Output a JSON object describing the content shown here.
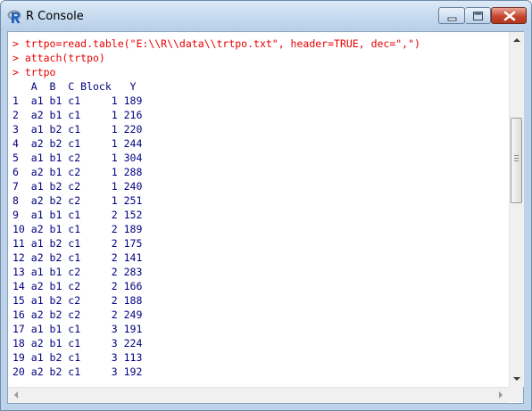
{
  "window": {
    "title": "R Console"
  },
  "console": {
    "lines": [
      {
        "kind": "cmd",
        "text": "> trtpo=read.table(\"E:\\\\R\\\\data\\\\trtpo.txt\", header=TRUE, dec=\",\")"
      },
      {
        "kind": "cmd",
        "text": "> attach(trtpo)"
      },
      {
        "kind": "cmd",
        "text": "> trtpo"
      },
      {
        "kind": "out",
        "text": "   A  B  C Block   Y"
      },
      {
        "kind": "out",
        "text": "1  a1 b1 c1     1 189"
      },
      {
        "kind": "out",
        "text": "2  a2 b1 c1     1 216"
      },
      {
        "kind": "out",
        "text": "3  a1 b2 c1     1 220"
      },
      {
        "kind": "out",
        "text": "4  a2 b2 c1     1 244"
      },
      {
        "kind": "out",
        "text": "5  a1 b1 c2     1 304"
      },
      {
        "kind": "out",
        "text": "6  a2 b1 c2     1 288"
      },
      {
        "kind": "out",
        "text": "7  a1 b2 c2     1 240"
      },
      {
        "kind": "out",
        "text": "8  a2 b2 c2     1 251"
      },
      {
        "kind": "out",
        "text": "9  a1 b1 c1     2 152"
      },
      {
        "kind": "out",
        "text": "10 a2 b1 c1     2 189"
      },
      {
        "kind": "out",
        "text": "11 a1 b2 c1     2 175"
      },
      {
        "kind": "out",
        "text": "12 a2 b2 c1     2 141"
      },
      {
        "kind": "out",
        "text": "13 a1 b1 c2     2 283"
      },
      {
        "kind": "out",
        "text": "14 a2 b1 c2     2 166"
      },
      {
        "kind": "out",
        "text": "15 a1 b2 c2     2 188"
      },
      {
        "kind": "out",
        "text": "16 a2 b2 c2     2 249"
      },
      {
        "kind": "out",
        "text": "17 a1 b1 c1     3 191"
      },
      {
        "kind": "out",
        "text": "18 a2 b1 c1     3 224"
      },
      {
        "kind": "out",
        "text": "19 a1 b2 c1     3 113"
      },
      {
        "kind": "out",
        "text": "20 a2 b2 c1     3 192"
      }
    ]
  },
  "colors": {
    "command": "#e60000",
    "output": "#000080"
  },
  "icons": {
    "app": "r-logo-icon",
    "minimize": "minimize-icon",
    "maximize": "maximize-icon",
    "close": "close-icon"
  }
}
